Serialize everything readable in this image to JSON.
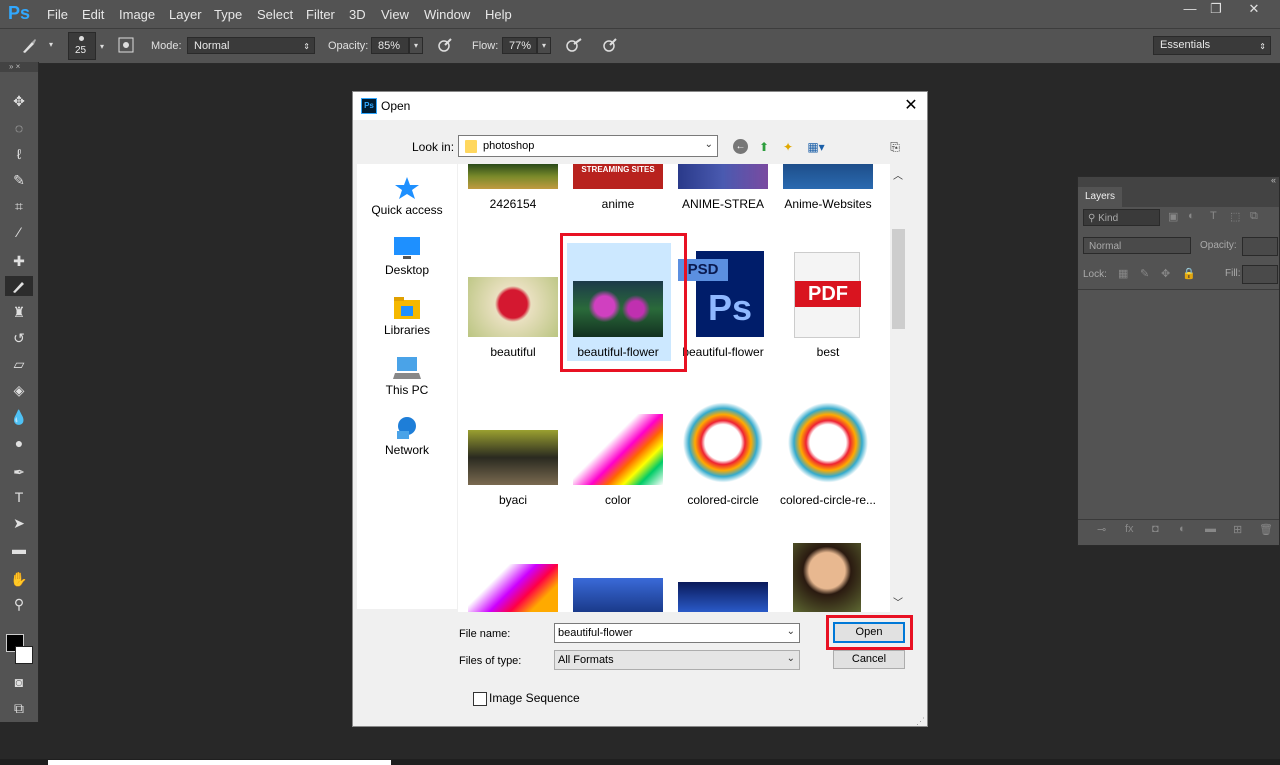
{
  "app": {
    "logo": "Ps"
  },
  "menu": [
    "File",
    "Edit",
    "Image",
    "Layer",
    "Type",
    "Select",
    "Filter",
    "3D",
    "View",
    "Window",
    "Help"
  ],
  "window_controls": {
    "minimize": "—",
    "restore": "❐",
    "close": "✕"
  },
  "options_bar": {
    "brush_size": "25",
    "mode_label": "Mode:",
    "mode_value": "Normal",
    "opacity_label": "Opacity:",
    "opacity_value": "85%",
    "flow_label": "Flow:",
    "flow_value": "77%",
    "workspace": "Essentials"
  },
  "layers_panel": {
    "tab": "Layers",
    "kind": "Kind",
    "blend_mode": "Normal",
    "opacity_label": "Opacity:",
    "lock_label": "Lock:",
    "fill_label": "Fill:"
  },
  "dialog": {
    "title": "Open",
    "look_in_label": "Look in:",
    "look_in_value": "photoshop",
    "places": [
      "Quick access",
      "Desktop",
      "Libraries",
      "This PC",
      "Network"
    ],
    "files_row1": [
      "2426154",
      "anime",
      "ANIME-STREA",
      "Anime-Websites"
    ],
    "files_row2": [
      "beautiful",
      "beautiful-flower",
      "beautiful-flower",
      "best"
    ],
    "files_row3": [
      "byaci",
      "color",
      "colored-circle",
      "colored-circle-re..."
    ],
    "streaming_banner_text": "STREAMING SITES",
    "psd_label": "PSD",
    "psd_icon_text": "Ps",
    "pdf_label": "PDF",
    "file_name_label": "File name:",
    "file_name_value": "beautiful-flower",
    "file_type_label": "Files of type:",
    "file_type_value": "All Formats",
    "open_button": "Open",
    "cancel_button": "Cancel",
    "image_sequence_label": "Image Sequence"
  }
}
